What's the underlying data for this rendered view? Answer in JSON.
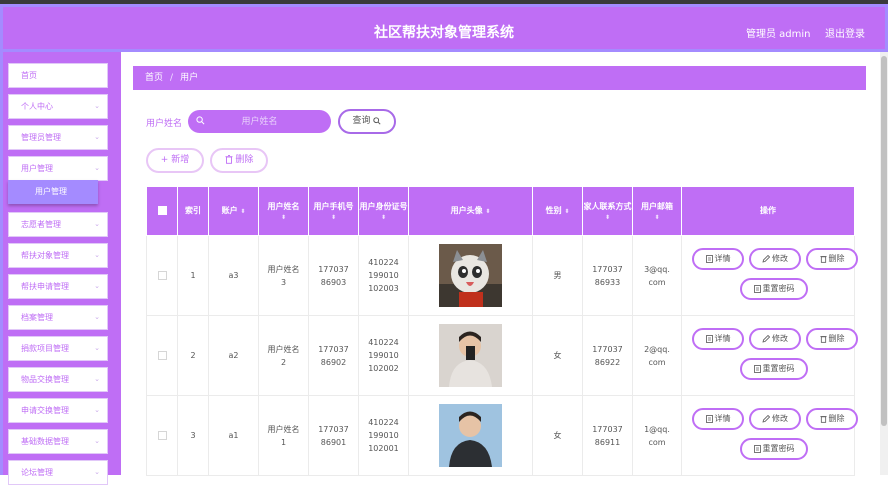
{
  "header": {
    "title": "社区帮扶对象管理系统",
    "admin_label": "管理员 admin",
    "logout_label": "退出登录"
  },
  "sidebar": {
    "items": [
      {
        "label": "首页",
        "has_chevron": false
      },
      {
        "label": "个人中心",
        "has_chevron": true
      },
      {
        "label": "管理员管理",
        "has_chevron": true
      },
      {
        "label": "用户管理",
        "has_chevron": true
      },
      {
        "label": "志愿者管理",
        "has_chevron": true
      },
      {
        "label": "帮扶对象管理",
        "has_chevron": true
      },
      {
        "label": "帮扶申请管理",
        "has_chevron": true
      },
      {
        "label": "档案管理",
        "has_chevron": true
      },
      {
        "label": "捐款项目管理",
        "has_chevron": true
      },
      {
        "label": "物品交换管理",
        "has_chevron": true
      },
      {
        "label": "申请交换管理",
        "has_chevron": true
      },
      {
        "label": "基础数据管理",
        "has_chevron": true
      },
      {
        "label": "论坛管理",
        "has_chevron": true
      }
    ],
    "active_sub": "用户管理"
  },
  "breadcrumb": {
    "home": "首页",
    "separator": "/",
    "current": "用户"
  },
  "search": {
    "label": "用户姓名",
    "placeholder": "用户姓名",
    "query_button": "查询"
  },
  "actions": {
    "add_label": "新增",
    "delete_label": "删除"
  },
  "table": {
    "headers": {
      "index": "索引",
      "account": "账户",
      "name": "用户姓名",
      "phone": "用户手机号",
      "id_card": "用户身份证号",
      "avatar": "用户头像",
      "gender": "性别",
      "family_phone": "家人联系方式",
      "email": "用户邮箱",
      "ops": "操作"
    },
    "rows": [
      {
        "index": "1",
        "account": "a3",
        "name": "用户姓名3",
        "phone": "17703786903",
        "id_card": "410224199010102003",
        "gender": "男",
        "family_phone": "17703786933",
        "email": "3@qq.com",
        "avatar": "cat-photo"
      },
      {
        "index": "2",
        "account": "a2",
        "name": "用户姓名2",
        "phone": "17703786902",
        "id_card": "410224199010102002",
        "gender": "女",
        "family_phone": "17703786922",
        "email": "2@qq.com",
        "avatar": "person-photo"
      },
      {
        "index": "3",
        "account": "a1",
        "name": "用户姓名1",
        "phone": "17703786901",
        "id_card": "410224199010102001",
        "gender": "女",
        "family_phone": "17703786911",
        "email": "1@qq.com",
        "avatar": "person-photo"
      }
    ],
    "op_labels": {
      "detail": "详情",
      "edit": "修改",
      "delete": "删除",
      "reset": "重置密码"
    }
  },
  "colors": {
    "accent": "#bf6ef5",
    "border_accent": "#a48bff"
  }
}
